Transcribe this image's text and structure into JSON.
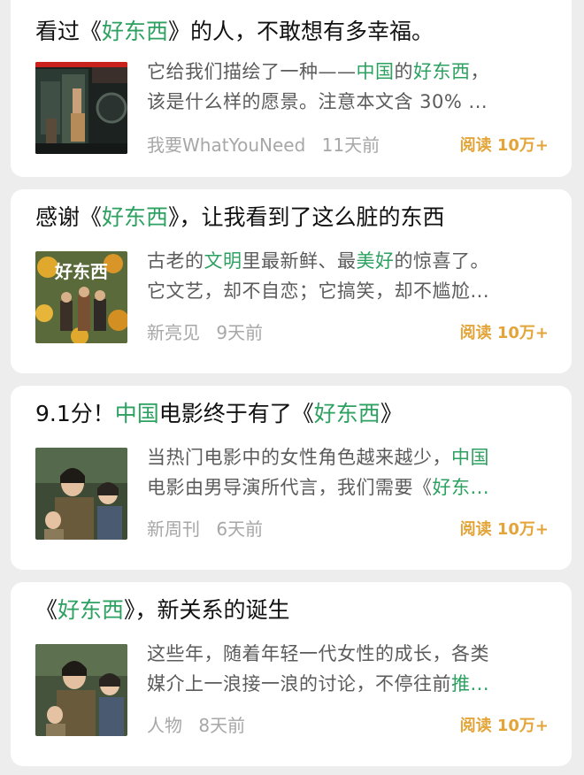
{
  "colors": {
    "link_green": "#2da160",
    "reads_orange": "#e3a53a",
    "meta_gray": "#a7a7a7"
  },
  "articles": [
    {
      "title": [
        {
          "t": "看过《"
        },
        {
          "t": "好东西",
          "hl": true
        },
        {
          "t": "》的人，不敢想有多幸福。"
        }
      ],
      "summary_lines": [
        [
          {
            "t": "它给我们描绘了一种——"
          },
          {
            "t": "中国",
            "hl": true
          },
          {
            "t": "的"
          },
          {
            "t": "好东西",
            "hl": true
          },
          {
            "t": "，"
          }
        ],
        [
          {
            "t": "该是什么样的愿景。注意本文含 30% ..."
          }
        ]
      ],
      "source": "我要WhatYouNeed",
      "time": "11天前",
      "reads": "阅读 10万+"
    },
    {
      "title": [
        {
          "t": "感谢《"
        },
        {
          "t": "好东西",
          "hl": true
        },
        {
          "t": "》，让我看到了这么脏的东西"
        }
      ],
      "summary_lines": [
        [
          {
            "t": "古老的"
          },
          {
            "t": "文明",
            "hl": true
          },
          {
            "t": "里最新鲜、最"
          },
          {
            "t": "美好",
            "hl": true
          },
          {
            "t": "的惊喜了。"
          }
        ],
        [
          {
            "t": "它文艺，却不自恋；它搞笑，却不尴尬..."
          }
        ]
      ],
      "source": "新亮见",
      "time": "9天前",
      "reads": "阅读 10万+"
    },
    {
      "title": [
        {
          "t": "9.1分！"
        },
        {
          "t": "中国",
          "hl": true
        },
        {
          "t": "电影终于有了《"
        },
        {
          "t": "好东西",
          "hl": true
        },
        {
          "t": "》"
        }
      ],
      "summary_lines": [
        [
          {
            "t": "当热门电影中的女性角色越来越少，"
          },
          {
            "t": "中国",
            "hl": true
          }
        ],
        [
          {
            "t": "电影由男导演所代言，我们需要《"
          },
          {
            "t": "好东...",
            "hl": true
          }
        ]
      ],
      "source": "新周刊",
      "time": "6天前",
      "reads": "阅读 10万+"
    },
    {
      "title": [
        {
          "t": "《"
        },
        {
          "t": "好东西",
          "hl": true
        },
        {
          "t": "》，新关系的诞生"
        }
      ],
      "summary_lines": [
        [
          {
            "t": "这些年，随着年轻一代女性的成长，各类"
          }
        ],
        [
          {
            "t": "媒介上一浪接一浪的讨论，不停往前"
          },
          {
            "t": "推...",
            "hl": true
          }
        ]
      ],
      "source": "人物",
      "time": "8天前",
      "reads": "阅读 10万+"
    }
  ],
  "thumbnails": [
    "night-balcony-scene-image",
    "movie-poster-image",
    "mother-daughter-still-image",
    "mother-daughter-still-image-2"
  ],
  "poster_text": "好东西"
}
